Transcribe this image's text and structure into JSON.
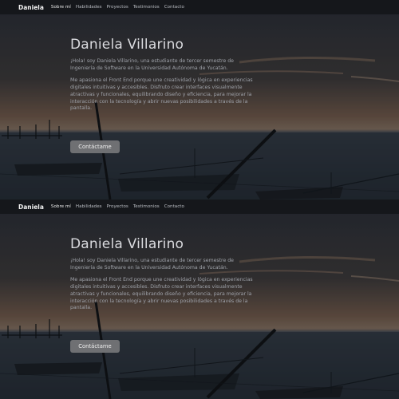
{
  "nav": {
    "brand": "Daniela",
    "links": [
      "Sobre mí",
      "Habilidades",
      "Proyectos",
      "Testimonios",
      "Contacto"
    ]
  },
  "hero": {
    "title": "Daniela Villarino",
    "intro": "¡Hola! soy Daniela Villarino, una estudiante de tercer semestre de Ingeniería de Software en la Universidad Autónoma de Yucatán.",
    "about": "Me apasiona el Front End porque une creatividad y lógica en experiencias digitales intuitivas y accesibles. Disfruto crear interfaces visualmente atractivas y funcionales, equilibrando diseño y eficiencia, para mejorar la interacción con la tecnología y abrir nuevas posibilidades a través de la pantalla.",
    "cta_label": "Contáctame"
  },
  "colors": {
    "navbar": "#15171b",
    "button": "#6f7073",
    "sky_top": "#2c2f38",
    "sunset": "#8a6a4e",
    "water": "#2a3440"
  }
}
